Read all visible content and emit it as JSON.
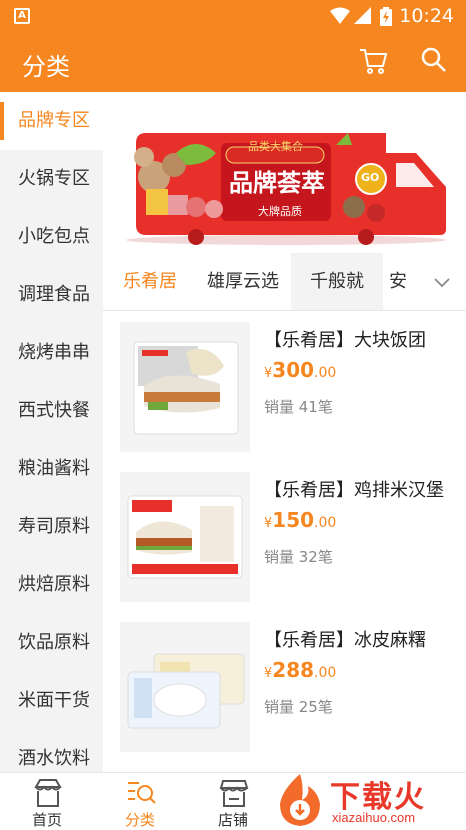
{
  "status_bar": {
    "time": "10:24"
  },
  "app_bar": {
    "title": "分类"
  },
  "sidebar": {
    "items": [
      {
        "label": "品牌专区",
        "active": true
      },
      {
        "label": "火锅专区"
      },
      {
        "label": "小吃包点"
      },
      {
        "label": "调理食品"
      },
      {
        "label": "烧烤串串"
      },
      {
        "label": "西式快餐"
      },
      {
        "label": "粮油酱料"
      },
      {
        "label": "寿司原料"
      },
      {
        "label": "烘焙原料"
      },
      {
        "label": "饮品原料"
      },
      {
        "label": "米面干货"
      },
      {
        "label": "酒水饮料"
      }
    ]
  },
  "banner": {
    "tag": "品类大集合",
    "headline": "品牌荟萃",
    "subline": "大牌品质",
    "go": "GO"
  },
  "brand_tabs": {
    "items": [
      "乐肴居",
      "雄厚云选",
      "千般就",
      "安"
    ],
    "active_index": 0
  },
  "products": [
    {
      "name": "【乐肴居】大块饭团",
      "currency": "¥",
      "price_int": "300",
      "price_dec": ".00",
      "sales": "销量 41笔"
    },
    {
      "name": "【乐肴居】鸡排米汉堡",
      "currency": "¥",
      "price_int": "150",
      "price_dec": ".00",
      "sales": "销量 32笔"
    },
    {
      "name": "【乐肴居】冰皮麻糬",
      "currency": "¥",
      "price_int": "288",
      "price_dec": ".00",
      "sales": "销量 25笔"
    }
  ],
  "bottom_nav": {
    "items": [
      {
        "label": "首页"
      },
      {
        "label": "分类",
        "active": true
      },
      {
        "label": "店铺"
      }
    ]
  },
  "watermark": {
    "text": "下载火",
    "url": "xiazaihuo.com"
  },
  "colors": {
    "accent": "#f6861f",
    "banner_red": "#e8302b"
  }
}
